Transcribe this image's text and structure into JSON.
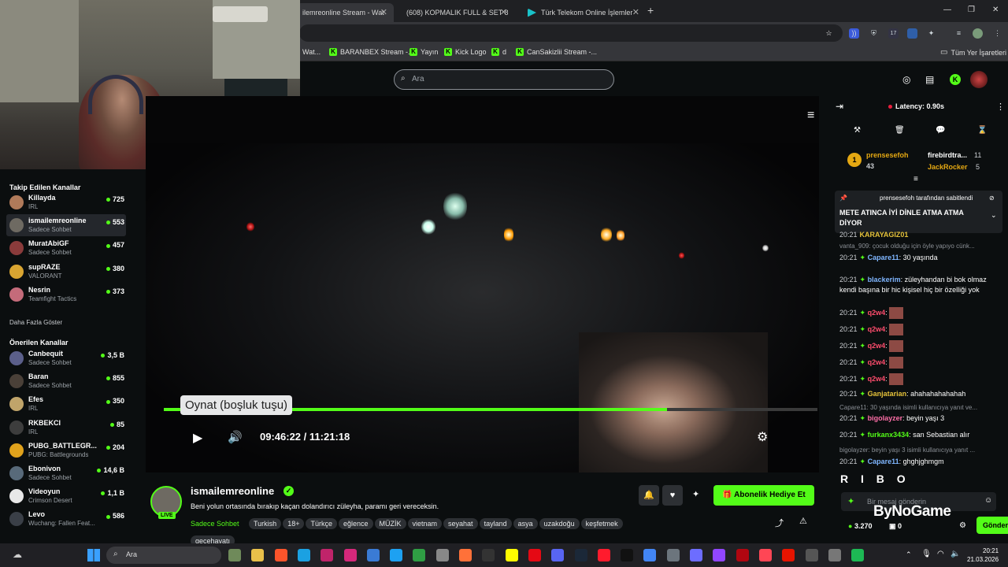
{
  "browser": {
    "tabs": [
      {
        "label": "ilemreonline Stream - Wat"
      },
      {
        "label": "(608) KOPMALIK FULL & SET 8"
      },
      {
        "label": "Türk Telekom Online İşlemler"
      }
    ],
    "new_tab": "+",
    "bookmarks": [
      {
        "label": "Wat..."
      },
      {
        "label": "BARANBEX Stream -..."
      },
      {
        "label": "Yayın"
      },
      {
        "label": "Kick Logo"
      },
      {
        "label": "d"
      },
      {
        "label": "CanSakizlii Stream -..."
      }
    ],
    "other_bookmarks": "Tüm Yer İşaretleri",
    "ext_badge": "17"
  },
  "kick_nav": {
    "search_placeholder": "Ara"
  },
  "sidebar": {
    "followed_heading": "Takip Edilen Kanallar",
    "followed": [
      {
        "name": "Killayda",
        "category": "IRL",
        "viewers": "725",
        "color": "#b07a5a"
      },
      {
        "name": "ismailemreonline",
        "category": "Sadece Sohbet",
        "viewers": "553",
        "color": "#6e6a62"
      },
      {
        "name": "MuratAbiGF",
        "category": "Sadece Sohbet",
        "viewers": "457",
        "color": "#8a3b3b"
      },
      {
        "name": "supRAZE",
        "category": "VALORANT",
        "viewers": "380",
        "color": "#d9a531"
      },
      {
        "name": "Nesrin",
        "category": "Teamfight Tactics",
        "viewers": "373",
        "color": "#c46b7a"
      }
    ],
    "show_more": "Daha Fazla Göster",
    "recommended_heading": "Önerilen Kanallar",
    "recommended": [
      {
        "name": "Canbequit",
        "category": "Sadece Sohbet",
        "viewers": "3,5 B",
        "color": "#5b5f8a"
      },
      {
        "name": "Baran",
        "category": "Sadece Sohbet",
        "viewers": "855",
        "color": "#4a4038"
      },
      {
        "name": "Efes",
        "category": "IRL",
        "viewers": "350",
        "color": "#c0a46a"
      },
      {
        "name": "RKBEKCI",
        "category": "IRL",
        "viewers": "85",
        "color": "#3d3d3d"
      },
      {
        "name": "PUBG_BATTLEGR...",
        "category": "PUBG: Battlegrounds",
        "viewers": "204",
        "color": "#e0a21c"
      },
      {
        "name": "Ebonivon",
        "category": "Sadece Sohbet",
        "viewers": "14,6 B",
        "color": "#586a7a"
      },
      {
        "name": "Videoyun",
        "category": "Crimson Desert",
        "viewers": "1,1 B",
        "color": "#e8e8e8"
      },
      {
        "name": "Levo",
        "category": "Wuchang: Fallen Feat...",
        "viewers": "586",
        "color": "#3a3f47"
      }
    ]
  },
  "player": {
    "tooltip": "Oynat (boşluk tuşu)",
    "current_time": "09:46:22",
    "separator": "/",
    "duration": "11:21:18",
    "progress": 0.77
  },
  "stream": {
    "streamer": "ismailemreonline",
    "live_label": "LIVE",
    "title": "Beni yolun ortasında bırakıp kaçan dolandırıcı züleyha, paramı geri vereceksin.",
    "category": "Sadece Sohbet",
    "tags": [
      "Turkish",
      "18+",
      "Türkçe",
      "eğlence",
      "MÜZİK",
      "vietnam",
      "seyahat",
      "tayland",
      "asya",
      "uzakdoğu",
      "keşfetmek",
      "gecehayatı"
    ],
    "gift_sub_label": "Abonelik Hediye Et"
  },
  "chat": {
    "latency": "Latency: 0.90s",
    "leaders": [
      {
        "rank": "1",
        "name": "prensesefoh",
        "count": "43"
      },
      {
        "name": "firebirdtra...",
        "count": "11"
      },
      {
        "name": "JackRocker",
        "count": "5"
      }
    ],
    "pinned_by": "prensesefoh tarafından sabitlendi",
    "pinned_text": "METE ATINCA İYİ DİNLE ATMA ATMA DİYOR",
    "partial_user": "KARAYAGIZ01",
    "messages": [
      {
        "type": "reply",
        "text": "vanta_909: çocuk olduğu için öyle yapıyo cünk..."
      },
      {
        "time": "20:21",
        "user": "Capare11",
        "text": "30 yaşında",
        "color": "#7fb6ff"
      },
      {
        "time": "20:21",
        "user": "blackerim",
        "text": "züleyhandan bi bok olmaz kendi başına bir hic kişisel hiç bir özelliği yok",
        "color": "#7fb6ff"
      },
      {
        "time": "20:21",
        "user": "q2w4",
        "text": "",
        "color": "#ff4d6d"
      },
      {
        "time": "20:21",
        "user": "q2w4",
        "text": "",
        "color": "#ff4d6d"
      },
      {
        "time": "20:21",
        "user": "q2w4",
        "text": "",
        "color": "#ff4d6d"
      },
      {
        "time": "20:21",
        "user": "q2w4",
        "text": "",
        "color": "#ff4d6d"
      },
      {
        "time": "20:21",
        "user": "q2w4",
        "text": "",
        "color": "#ff4d6d"
      },
      {
        "time": "20:21",
        "user": "Ganjatarian",
        "text": "ahahahahahahah",
        "color": "#e5c23a"
      },
      {
        "type": "reply",
        "text": "Capare11: 30 yaşında isimli kullanıcıya yanıt ve..."
      },
      {
        "time": "20:21",
        "user": "bigolayzer",
        "text": "beyin yaşı 3",
        "color": "#ff6fa8"
      },
      {
        "time": "20:21",
        "user": "furkanx3434",
        "text": "san Sebastian alır",
        "color": "#53fc18"
      },
      {
        "type": "reply",
        "text": "bigolayzer: beyin yaşı 3 isimli kullanıcıya yanıt ..."
      },
      {
        "time": "20:21",
        "user": "Capare11",
        "text": "ghghjghmgm",
        "color": "#7fb6ff"
      }
    ],
    "ribo": "R I B O",
    "input_placeholder": "Bir mesaj gönderin",
    "watermark": "ByNoGame",
    "points": "3.270",
    "zero_count": "0",
    "send_label": "Gönder"
  },
  "taskbar": {
    "search_label": "Ara",
    "time": "20:21",
    "date": "21.03.2026"
  },
  "colors": {
    "kick_green": "#53fc18",
    "background": "#0b0e0f"
  }
}
